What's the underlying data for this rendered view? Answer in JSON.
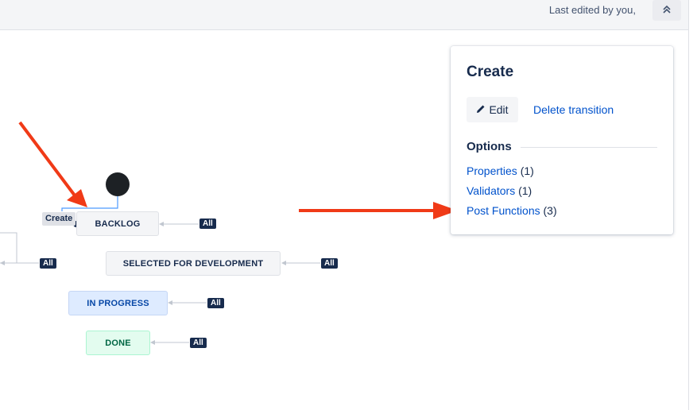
{
  "header": {
    "last_edited": "Last edited by you,",
    "collapse_icon": "double-chevron-up-icon"
  },
  "workflow": {
    "create_label": "Create",
    "statuses": [
      {
        "label": "BACKLOG",
        "color": "#f4f5f7"
      },
      {
        "label": "SELECTED FOR DEVELOPMENT",
        "color": "#f4f5f7"
      },
      {
        "label": "IN PROGRESS",
        "color": "#deebff"
      },
      {
        "label": "DONE",
        "color": "#e3fcef"
      }
    ],
    "all_badge": "All"
  },
  "panel": {
    "title": "Create",
    "edit_label": "Edit",
    "edit_icon": "pencil-icon",
    "delete_label": "Delete transition",
    "options_title": "Options",
    "options": [
      {
        "label": "Properties",
        "count": "(1)"
      },
      {
        "label": "Validators",
        "count": "(1)"
      },
      {
        "label": "Post Functions",
        "count": "(3)"
      }
    ]
  },
  "annotation_color": "#f03a17"
}
